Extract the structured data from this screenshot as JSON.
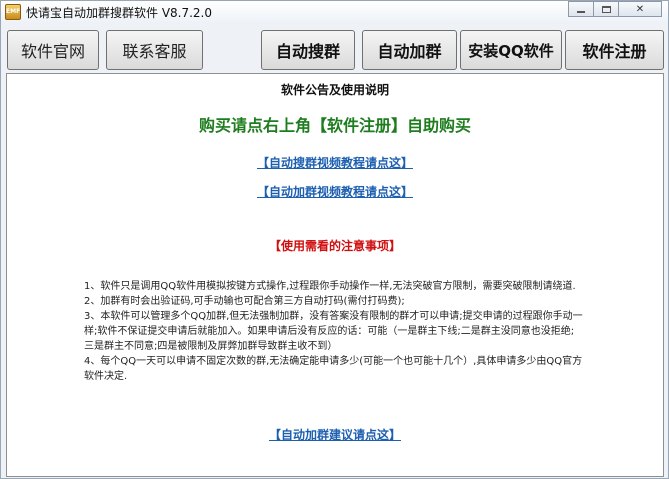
{
  "window": {
    "title": "快请宝自动加群搜群软件 V8.7.2.0",
    "icon_name": "app-logo-icon",
    "icon_text": "EMF"
  },
  "toolbar": {
    "official_site": "软件官网",
    "contact_support": "联系客服",
    "auto_search": "自动搜群",
    "auto_join": "自动加群",
    "install_qq": "安装QQ软件",
    "register": "软件注册"
  },
  "content": {
    "notice_title": "软件公告及使用说明",
    "buy_text": "购买请点右上角【软件注册】自助购买",
    "link_search_video": "【自动搜群视频教程请点这】",
    "link_join_video": "【自动加群视频教程请点这】",
    "warning_title": "【使用需看的注意事项】",
    "notes": [
      "1、软件只是调用QQ软件用模拟按键方式操作,过程跟你手动操作一样,无法突破官方限制，需要突破限制请绕道.",
      "2、加群有时会出验证码,可手动输也可配合第三方自动打码(需付打码费);",
      "3、本软件可以管理多个QQ加群,但无法强制加群，没有答案没有限制的群才可以申请;提交申请的过程跟你手动一样;软件不保证提交申请后就能加入。如果申请后没有反应的话：可能（一是群主下线;二是群主没同意也没拒绝;三是群主不同意;四是被限制及屏弊加群导致群主收不到）",
      "4、每个QQ一天可以申请不固定次数的群,无法确定能申请多少(可能一个也可能十几个）,具体申请多少由QQ官方软件决定."
    ],
    "link_suggest": "【自动加群建议请点这】"
  },
  "colors": {
    "buy_text": "#1e7d1e",
    "link": "#1c5fb0",
    "warning": "#d01010"
  }
}
